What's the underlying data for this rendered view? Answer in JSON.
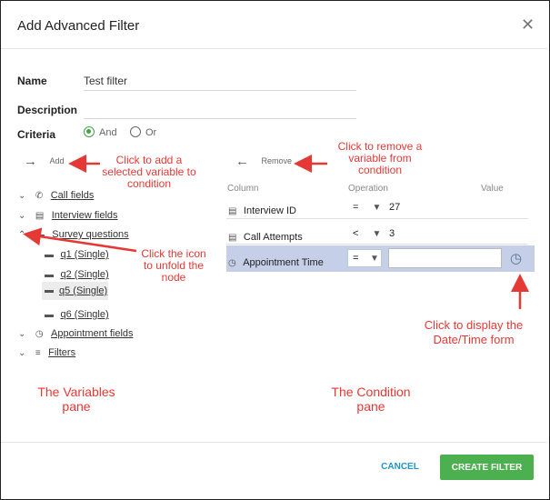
{
  "dialog": {
    "title": "Add Advanced Filter",
    "close_icon": "close-icon"
  },
  "form": {
    "name_label": "Name",
    "name_value": "Test filter",
    "description_label": "Description",
    "description_value": "",
    "criteria_label": "Criteria",
    "criteria_options": [
      {
        "label": "And",
        "selected": true
      },
      {
        "label": "Or",
        "selected": false
      }
    ]
  },
  "variables_pane": {
    "add_label": "Add",
    "tree": [
      {
        "label": "Call fields",
        "icon": "phone-icon",
        "expanded": false
      },
      {
        "label": "Interview fields",
        "icon": "list-icon",
        "expanded": false
      },
      {
        "label": "Survey questions",
        "icon": "comment-icon",
        "expanded": true,
        "children": [
          {
            "label": "q1 (Single)",
            "icon": "comment-icon"
          },
          {
            "label": "q2 (Single)",
            "icon": "comment-icon"
          },
          {
            "label": "q5 (Single)",
            "icon": "comment-icon",
            "highlighted": true
          },
          {
            "label": "q6 (Single)",
            "icon": "comment-icon"
          }
        ]
      },
      {
        "label": "Appointment fields",
        "icon": "clock-icon",
        "expanded": false
      },
      {
        "label": "Filters",
        "icon": "filter-icon",
        "expanded": false
      }
    ]
  },
  "condition_pane": {
    "remove_label": "Remove",
    "columns": [
      "Column",
      "Operation",
      "Value"
    ],
    "rows": [
      {
        "column": "Interview ID",
        "icon": "list-icon",
        "operation": "=",
        "value": "27"
      },
      {
        "column": "Call Attempts",
        "icon": "list-icon",
        "operation": "<",
        "value": "3"
      },
      {
        "column": "Appointment Time",
        "icon": "clock-icon",
        "operation": "=",
        "value": "",
        "selected": true
      }
    ]
  },
  "annotations": {
    "add_note": "Click to add a selected variable to condition",
    "remove_note": "Click to remove a variable from condition",
    "unfold_note": "Click the icon to unfold the node",
    "datetime_note": "Click to display the Date/Time form",
    "variables_pane_label": "The Variables pane",
    "condition_pane_label": "The Condition pane"
  },
  "footer": {
    "cancel_label": "CANCEL",
    "create_label": "CREATE FILTER"
  },
  "colors": {
    "accent_green": "#4caf50",
    "link_blue": "#2196c9",
    "annotation_red": "#e53935",
    "selected_row": "#c5cfe8"
  }
}
